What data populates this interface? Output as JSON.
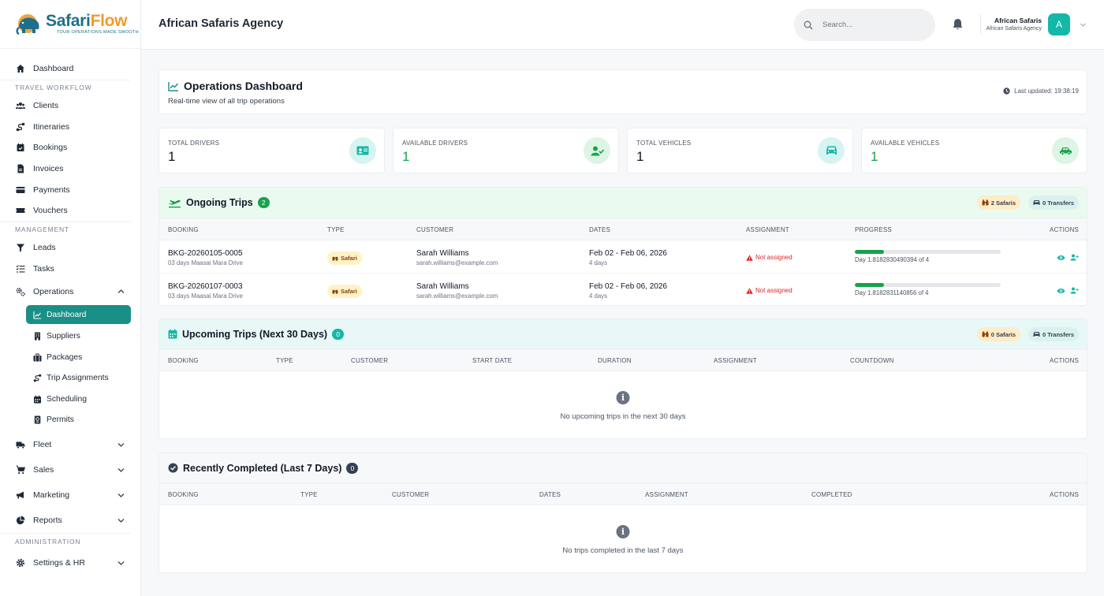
{
  "brand": {
    "name_part1": "Safari",
    "name_part2": "Flow",
    "tagline": "TOUR OPERATIONS MADE SMOOTH"
  },
  "sidebar": {
    "dashboard": "Dashboard",
    "sections": {
      "travel": "TRAVEL WORKFLOW",
      "management": "MANAGEMENT",
      "administration": "ADMINISTRATION"
    },
    "travel_items": [
      "Clients",
      "Itineraries",
      "Bookings",
      "Invoices",
      "Payments",
      "Vouchers"
    ],
    "management_items": [
      "Leads",
      "Tasks"
    ],
    "operations": "Operations",
    "operations_sub": [
      "Dashboard",
      "Suppliers",
      "Packages",
      "Trip Assignments",
      "Scheduling",
      "Permits"
    ],
    "collapsed": [
      "Fleet",
      "Sales",
      "Marketing",
      "Reports"
    ],
    "settings": "Settings & HR"
  },
  "header": {
    "agency": "African Safaris Agency",
    "search_placeholder": "Search...",
    "user_name": "African Safaris",
    "user_org": "African Safaris Agency",
    "avatar_letter": "A"
  },
  "ops": {
    "title": "Operations Dashboard",
    "subtitle": "Real-time view of all trip operations",
    "last_updated": "Last updated: 19:38:19"
  },
  "stats": [
    {
      "label": "TOTAL DRIVERS",
      "value": "1"
    },
    {
      "label": "AVAILABLE DRIVERS",
      "value": "1"
    },
    {
      "label": "TOTAL VEHICLES",
      "value": "1"
    },
    {
      "label": "AVAILABLE VEHICLES",
      "value": "1"
    }
  ],
  "ongoing": {
    "title": "Ongoing Trips",
    "count": "2",
    "safaris": "2 Safaris",
    "transfers": "0 Transfers",
    "headers": [
      "BOOKING",
      "TYPE",
      "CUSTOMER",
      "DATES",
      "ASSIGNMENT",
      "PROGRESS",
      "ACTIONS"
    ],
    "rows": [
      {
        "booking": "BKG-20260105-0005",
        "package": "03 days Maasai Mara Drive",
        "type": "Safari",
        "customer": "Sarah Williams",
        "email": "sarah.williams@example.com",
        "dates": "Feb 02 - Feb 06, 2026",
        "days": "4 days",
        "assignment": "Not assigned",
        "progress": 0.2,
        "progress_text": "Day 1.8182830490394 of 4"
      },
      {
        "booking": "BKG-20260107-0003",
        "package": "03 days Maasai Mara Drive",
        "type": "Safari",
        "customer": "Sarah Williams",
        "email": "sarah.williams@example.com",
        "dates": "Feb 02 - Feb 06, 2026",
        "days": "4 days",
        "assignment": "Not assigned",
        "progress": 0.2,
        "progress_text": "Day 1.8182831140856 of 4"
      }
    ]
  },
  "upcoming": {
    "title": "Upcoming Trips (Next 30 Days)",
    "count": "0",
    "safaris": "0 Safaris",
    "transfers": "0 Transfers",
    "headers": [
      "BOOKING",
      "TYPE",
      "CUSTOMER",
      "START DATE",
      "DURATION",
      "ASSIGNMENT",
      "COUNTDOWN",
      "ACTIONS"
    ],
    "empty": "No upcoming trips in the next 30 days"
  },
  "completed": {
    "title": "Recently Completed (Last 7 Days)",
    "count": "0",
    "headers": [
      "BOOKING",
      "TYPE",
      "CUSTOMER",
      "DATES",
      "ASSIGNMENT",
      "COMPLETED",
      "ACTIONS"
    ],
    "empty": "No trips completed in the last 7 days"
  },
  "colors": {
    "accent": "#1a8f86",
    "success": "#16a34a",
    "danger": "#dc2626"
  }
}
